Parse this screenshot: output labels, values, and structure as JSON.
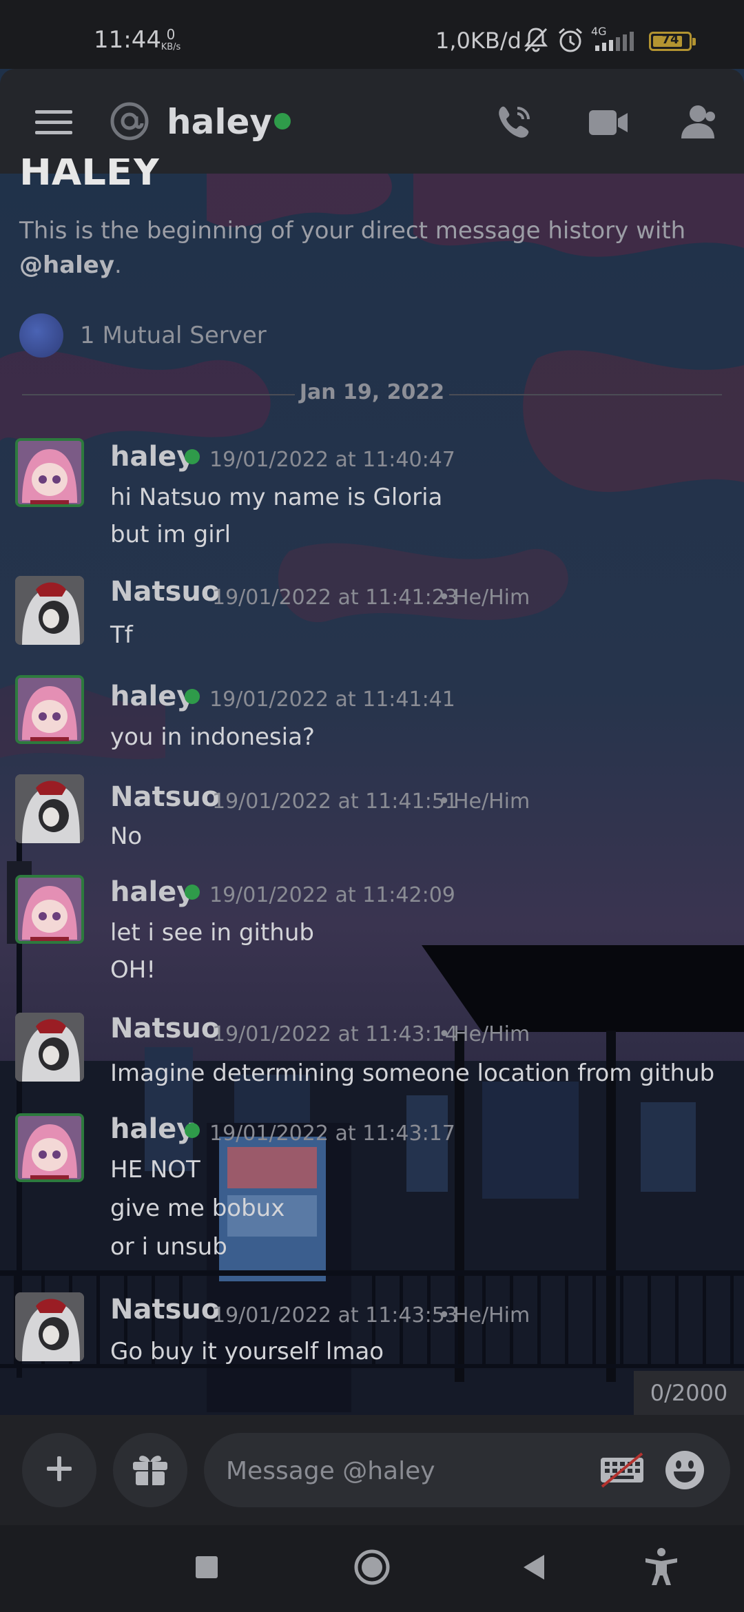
{
  "status_bar": {
    "time": "11:44",
    "net_speed_value": "0",
    "net_speed_unit": "KB/s",
    "data_rate": "1,0KB/d",
    "network_type": "4G",
    "battery_level": "74",
    "colors": {
      "battery": "#b39431"
    }
  },
  "header": {
    "channel_name": "haley",
    "icons": [
      "menu-icon",
      "at-icon",
      "online-status-icon",
      "voice-call-icon",
      "video-call-icon",
      "members-icon"
    ]
  },
  "intro": {
    "title": "HALEY",
    "text_prefix": "This is the beginning of your direct message history with",
    "mention": "@haley",
    "text_suffix": ".",
    "mutual_servers": "1 Mutual Server"
  },
  "date_divider": "Jan 19, 2022",
  "messages": [
    {
      "author": "haley",
      "timestamp": "19/01/2022 at 11:40:47",
      "pronouns": "",
      "online": true,
      "lines": [
        "hi Natsuo my name is Gloria",
        "but im girl"
      ]
    },
    {
      "author": "Natsuo",
      "timestamp": "19/01/2022 at 11:41:23",
      "pronouns": "He/Him",
      "online": false,
      "lines": [
        "Tf"
      ]
    },
    {
      "author": "haley",
      "timestamp": "19/01/2022 at 11:41:41",
      "pronouns": "",
      "online": true,
      "lines": [
        "you in indonesia?"
      ]
    },
    {
      "author": "Natsuo",
      "timestamp": "19/01/2022 at 11:41:51",
      "pronouns": "He/Him",
      "online": false,
      "lines": [
        "No"
      ]
    },
    {
      "author": "haley",
      "timestamp": "19/01/2022 at 11:42:09",
      "pronouns": "",
      "online": true,
      "lines": [
        "let i see in github",
        "OH!"
      ]
    },
    {
      "author": "Natsuo",
      "timestamp": "19/01/2022 at 11:43:14",
      "pronouns": "He/Him",
      "online": false,
      "lines": [
        "Imagine determining someone location from github"
      ]
    },
    {
      "author": "haley",
      "timestamp": "19/01/2022 at 11:43:17",
      "pronouns": "",
      "online": true,
      "lines": [
        "HE NOT",
        "give me bobux",
        "or i unsub"
      ]
    },
    {
      "author": "Natsuo",
      "timestamp": "19/01/2022 at 11:43:53",
      "pronouns": "He/Him",
      "online": false,
      "lines": [
        "Go buy it yourself lmao"
      ]
    }
  ],
  "composer": {
    "char_count": "0/2000",
    "placeholder": "Message @haley",
    "value": "",
    "icons": [
      "add-icon",
      "gift-icon",
      "keyboard-off-icon",
      "emoji-icon"
    ]
  },
  "nav_bar": {
    "icons": [
      "recents-icon",
      "home-icon",
      "back-icon",
      "accessibility-icon"
    ]
  },
  "colors": {
    "online": "#2f9b4a",
    "header_bg": "#24262b",
    "composer_bg": "#212226"
  }
}
